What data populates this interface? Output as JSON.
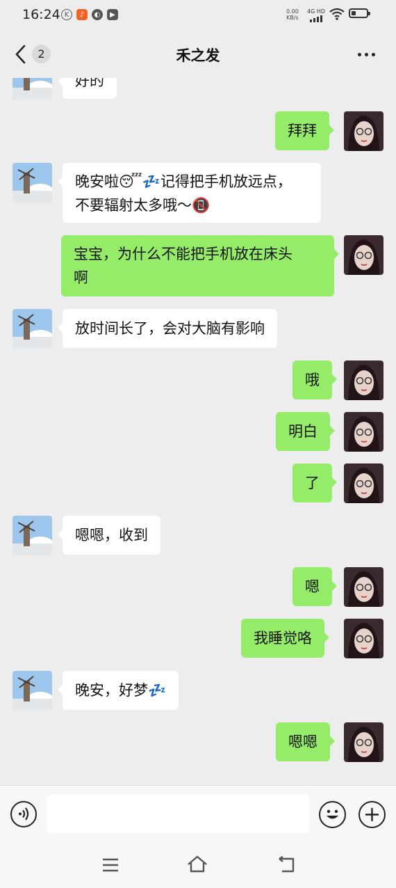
{
  "status": {
    "time": "16:24",
    "net_speed": "0.00",
    "net_unit": "KB/s",
    "signal_label": "4G HD",
    "battery_level": 0.3
  },
  "header": {
    "title": "禾之发",
    "unread_count": "2"
  },
  "messages": [
    {
      "side": "in",
      "text": "好的"
    },
    {
      "side": "out",
      "text": "拜拜"
    },
    {
      "side": "in",
      "line1": "晚安啦😴💤记得把手机放远点，",
      "line2": "不要辐射太多哦～📵"
    },
    {
      "side": "out",
      "line1": "宝宝，为什么不能把手机放在床头",
      "line2": "啊"
    },
    {
      "side": "in",
      "text": "放时间长了，会对大脑有影响"
    },
    {
      "side": "out",
      "text": "哦"
    },
    {
      "side": "out",
      "text": "明白"
    },
    {
      "side": "out",
      "text": "了"
    },
    {
      "side": "in",
      "text": "嗯嗯，收到"
    },
    {
      "side": "out",
      "text": "嗯"
    },
    {
      "side": "out",
      "text": "我睡觉咯"
    },
    {
      "side": "in",
      "text": "晚安，好梦💤"
    },
    {
      "side": "out",
      "text": "嗯嗯"
    }
  ],
  "colors": {
    "outgoing_bubble": "#95ec69",
    "incoming_bubble": "#ffffff",
    "background": "#ededed"
  },
  "icons": {
    "back": "chevron-left-icon",
    "more": "more-icon",
    "voice": "voice-icon",
    "emoji": "emoji-icon",
    "plus": "plus-icon"
  }
}
